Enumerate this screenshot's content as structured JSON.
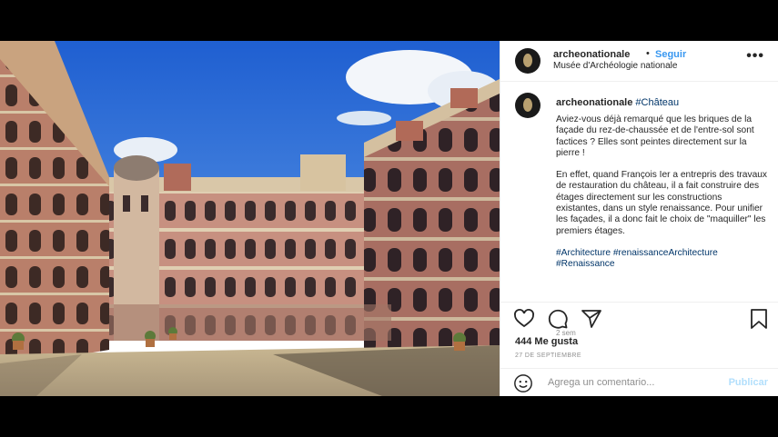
{
  "post": {
    "username": "archeonationale",
    "separator": "•",
    "follow_label": "Seguir",
    "location": "Musée d'Archéologie nationale",
    "more_label": "•••"
  },
  "caption": {
    "username": "archeonationale",
    "title_tag": "#Château",
    "paragraph1": "Aviez-vous déjà remarqué que les briques de la façade du rez-de-chaussée et de l'entre-sol sont factices ? Elles sont peintes directement sur la pierre !",
    "paragraph2": "En effet, quand François Ier a entrepris des travaux de restauration du château, il a fait construire des étages directement sur les constructions existantes, dans un style renaissance. Pour unifier les façades, il a donc fait le choix de \"maquiller\" les premiers étages.",
    "hashtags": "#Architecture #renaissanceArchitecture #Renaissance",
    "time_ago": "2 sem"
  },
  "actions": {
    "like_icon": "heart-icon",
    "comment_icon": "speech-bubble-icon",
    "share_icon": "paper-plane-icon",
    "save_icon": "bookmark-icon",
    "likes": "444 Me gusta",
    "date": "27 DE SEPTIEMBRE"
  },
  "comment_box": {
    "emoji_icon": "smiley-icon",
    "placeholder": "Agrega un comentario...",
    "publish_label": "Publicar"
  }
}
